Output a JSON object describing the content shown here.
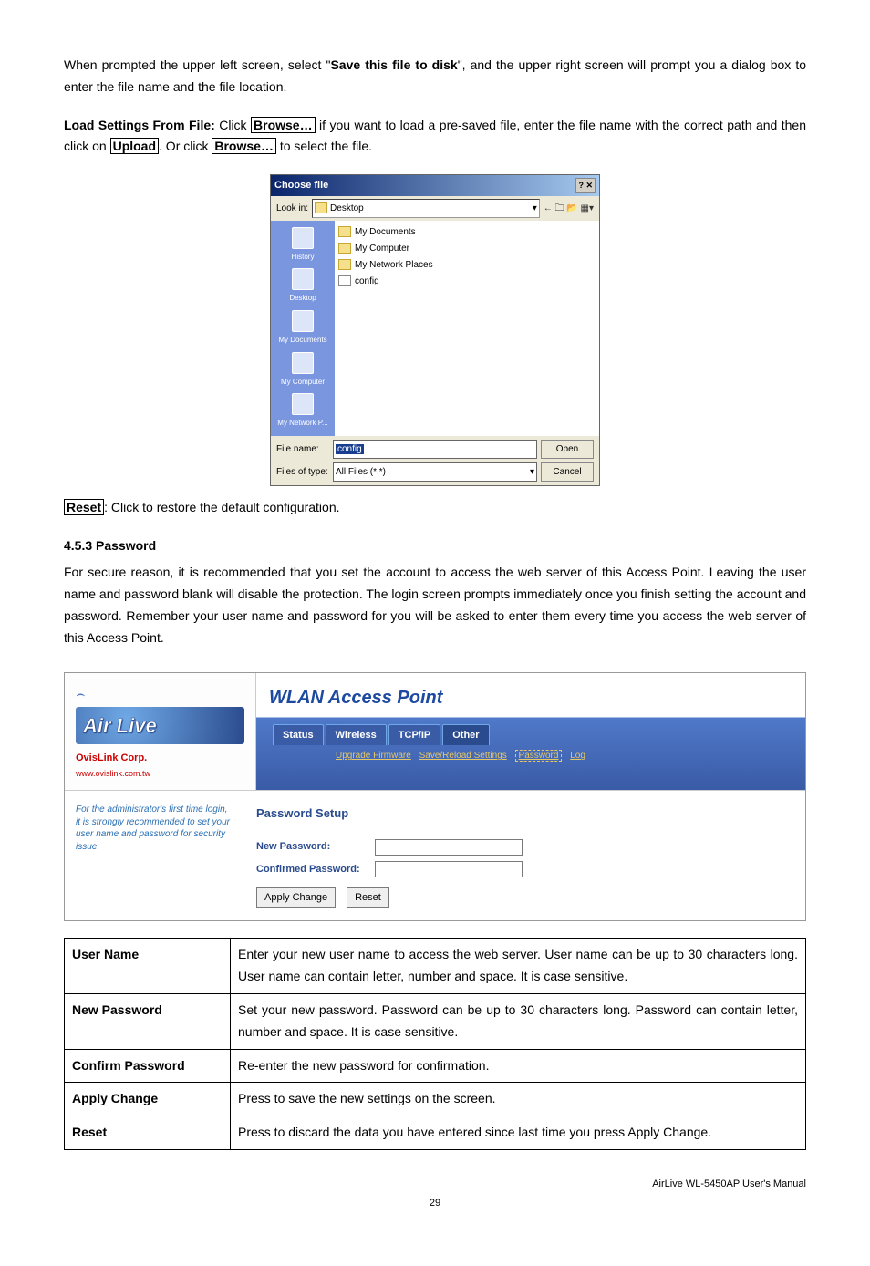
{
  "intro": {
    "p1_a": "When prompted the upper left screen, select \"",
    "p1_bold": "Save this file to disk",
    "p1_b": "\", and the upper right screen will prompt you a dialog box to enter the file name and the file location.",
    "p2_lead": "Load Settings From File:",
    "p2_a": " Click ",
    "p2_btn1": "Browse…",
    "p2_b": " if you want to load a pre-saved file, enter the file name with the correct path and then click on ",
    "p2_btn2": "Upload",
    "p2_c": ". Or click ",
    "p2_btn3": "Browse…",
    "p2_d": " to select the file."
  },
  "file_dialog": {
    "title": "Choose file",
    "lookin_label": "Look in:",
    "lookin_value": "Desktop",
    "toolbar_icons": "← 🗀 📂 ▦▾",
    "sidebar": [
      "History",
      "Desktop",
      "My Documents",
      "My Computer",
      "My Network P..."
    ],
    "files": [
      "My Documents",
      "My Computer",
      "My Network Places",
      "config"
    ],
    "filename_label": "File name:",
    "filename_value": "config",
    "filetype_label": "Files of type:",
    "filetype_value": "All Files (*.*)",
    "open_btn": "Open",
    "cancel_btn": "Cancel",
    "winbtns": "? ✕"
  },
  "reset_line_btn": "Reset",
  "reset_line_text": ": Click to restore the default configuration.",
  "section_heading": "4.5.3 Password",
  "section_body": "For secure reason, it is recommended that you set the account to access the web server of this Access Point. Leaving the user name and password blank will disable the protection. The login screen prompts immediately once you finish setting the account and password.   Remember your user name and password for you will be asked to enter them every time you access the web server of this Access Point.",
  "router": {
    "logo": "Air Live",
    "corp": "OvisLink Corp.",
    "url": "www.ovislink.com.tw",
    "title": "WLAN Access Point",
    "tabs": [
      "Status",
      "Wireless",
      "TCP/IP",
      "Other"
    ],
    "subnav": {
      "item1": "Upgrade Firmware",
      "item2": "Save/Reload Settings",
      "item3": "Password",
      "item4": "Log"
    },
    "help": "For the administrator's first time login, it is strongly recommended to set your user name and password for security issue.",
    "form_title": "Password Setup",
    "field1": "New Password:",
    "field2": "Confirmed Password:",
    "apply": "Apply Change",
    "reset": "Reset"
  },
  "table": {
    "r1k": "User Name",
    "r1v": "Enter your new user name to access the web server. User name can be up to 30 characters long. User name can contain letter, number and space. It is case sensitive.",
    "r2k": "New Password",
    "r2v": "Set your new password. Password can be up to 30 characters long. Password can contain letter, number and space. It is case sensitive.",
    "r3k": "Confirm Password",
    "r3v": "Re-enter the new password for confirmation.",
    "r4k": "Apply Change",
    "r4v": "Press to save the new settings on the screen.",
    "r5k": "Reset",
    "r5v": "Press to discard the data you have entered since last time you press Apply Change."
  },
  "footer": "AirLive WL-5450AP User's Manual",
  "page": "29"
}
